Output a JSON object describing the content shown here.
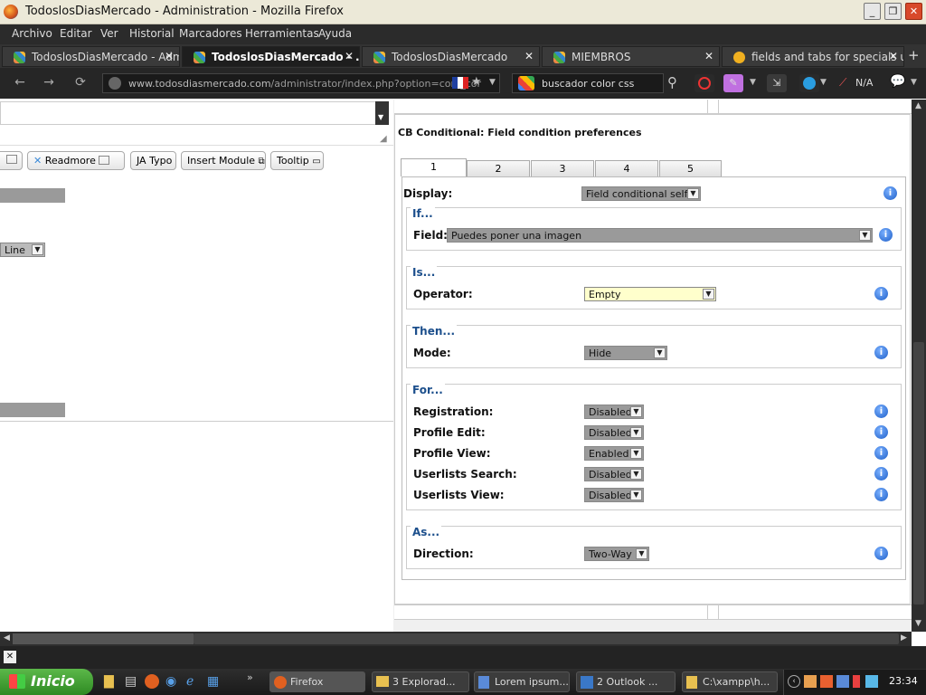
{
  "window": {
    "title": "TodoslosDiasMercado - Administration - Mozilla Firefox",
    "min": "_",
    "max": "❐",
    "close": "✕"
  },
  "menu": [
    "Archivo",
    "Editar",
    "Ver",
    "Historial",
    "Marcadores",
    "Herramientas",
    "Ayuda"
  ],
  "tabs": [
    {
      "label": "TodoslosDiasMercado - Admi...",
      "close": "✕"
    },
    {
      "label": "TodoslosDiasMercado - ...",
      "close": "✕"
    },
    {
      "label": "TodoslosDiasMercado",
      "close": "✕"
    },
    {
      "label": "MIEMBROS",
      "close": "✕"
    },
    {
      "label": "fields and tabs for specials u...",
      "close": "✕"
    }
  ],
  "new_tab": "+",
  "nav": {
    "back": "←",
    "forward": "→",
    "reload": "⟳",
    "url_domain": "www.todosdiasmercado.com",
    "url_path": "/administrator/index.php?option=com_cor",
    "search_value": "buscador color css",
    "na_label": "N/A"
  },
  "editor_buttons": {
    "readmore": "Readmore",
    "ja_typo": "JA Typo",
    "insert_module": "Insert Module",
    "tooltip": "Tooltip"
  },
  "left_select": "Line",
  "panel": {
    "title": "CB Conditional: Field condition preferences",
    "tabs": [
      "1",
      "2",
      "3",
      "4",
      "5"
    ],
    "display_label": "Display:",
    "display_value": "Field conditional self",
    "if_legend": "If...",
    "field_label": "Field:",
    "field_value": "Puedes poner una imagen",
    "is_legend": "Is...",
    "operator_label": "Operator:",
    "operator_value": "Empty",
    "then_legend": "Then...",
    "mode_label": "Mode:",
    "mode_value": "Hide",
    "for_legend": "For...",
    "for_rows": [
      {
        "label": "Registration:",
        "value": "Disabled"
      },
      {
        "label": "Profile Edit:",
        "value": "Disabled"
      },
      {
        "label": "Profile View:",
        "value": "Enabled"
      },
      {
        "label": "Userlists Search:",
        "value": "Disabled"
      },
      {
        "label": "Userlists View:",
        "value": "Disabled"
      }
    ],
    "as_legend": "As...",
    "direction_label": "Direction:",
    "direction_value": "Two-Way"
  },
  "findbar_close": "✕",
  "taskbar": {
    "start": "Inicio",
    "tasks": [
      {
        "label": "Firefox"
      },
      {
        "label": "3 Explorad..."
      },
      {
        "label": "Lorem ipsum..."
      },
      {
        "label": "2 Outlook ..."
      },
      {
        "label": "C:\\xampp\\h..."
      }
    ],
    "clock": "23:34"
  },
  "colors": {
    "accent_blue": "#1c4f8c",
    "operator_bg": "#ffffcc",
    "select_grey": "#9a9a9a"
  }
}
